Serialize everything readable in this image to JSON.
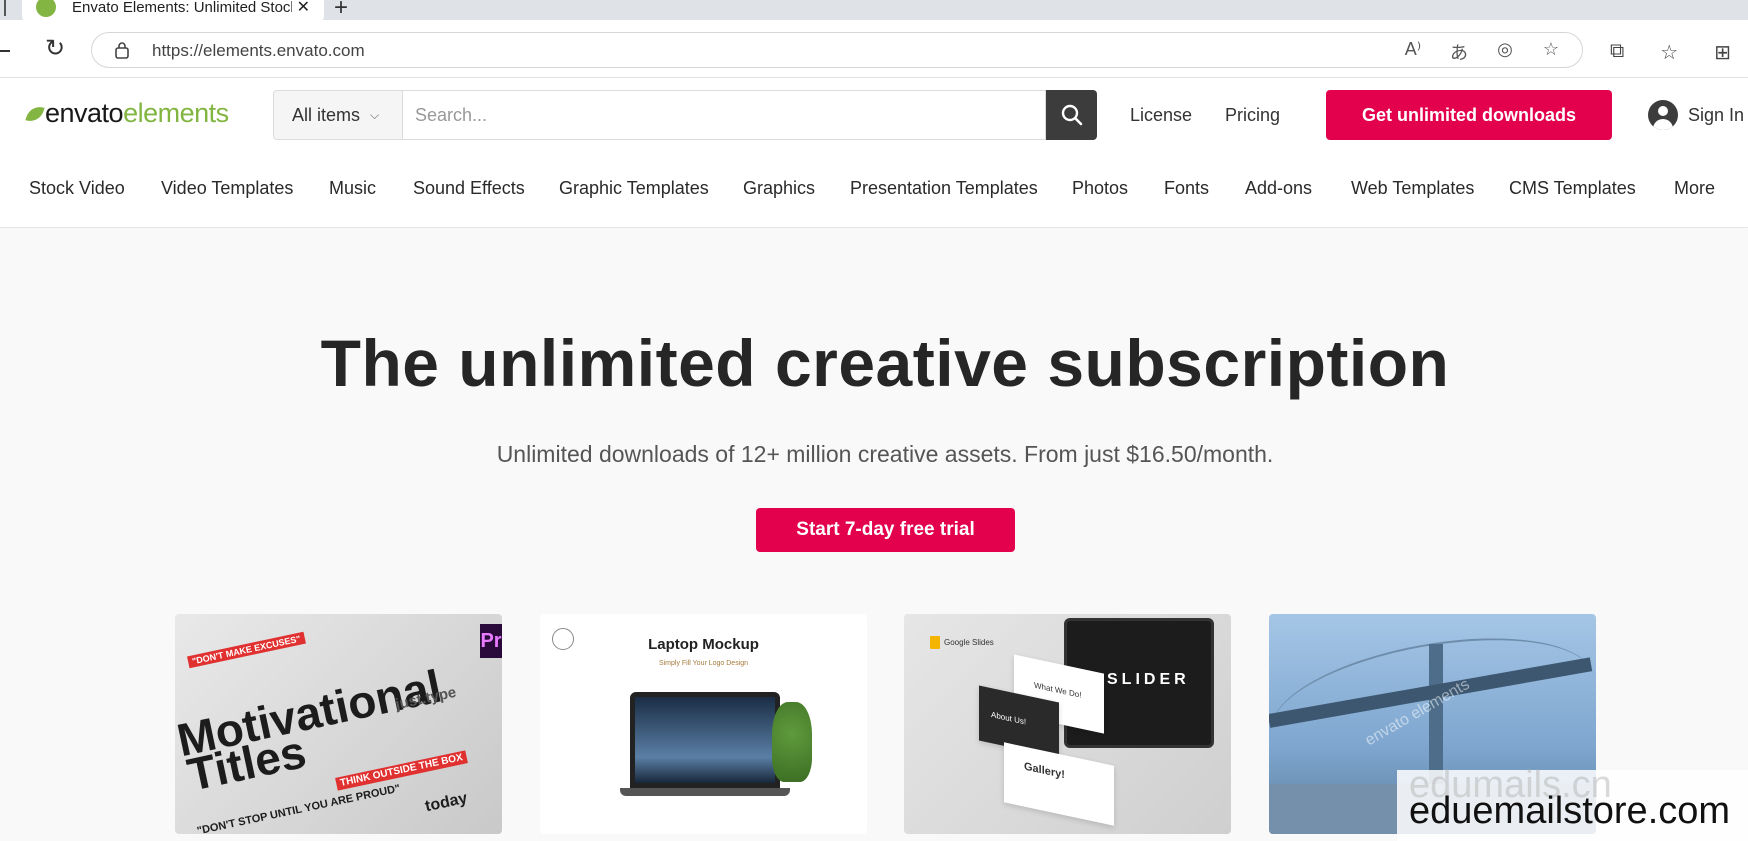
{
  "browser": {
    "tab_title": "Envato Elements: Unlimited Stock",
    "tab_close": "✕",
    "new_tab": "+",
    "url": "https://elements.envato.com"
  },
  "header": {
    "logo_envato": "envato",
    "logo_elements": "elements",
    "filter_label": "All items",
    "search_placeholder": "Search...",
    "license": "License",
    "pricing": "Pricing",
    "cta": "Get unlimited downloads",
    "sign_in": "Sign In"
  },
  "categories": [
    "Stock Video",
    "Video Templates",
    "Music",
    "Sound Effects",
    "Graphic Templates",
    "Graphics",
    "Presentation Templates",
    "Photos",
    "Fonts",
    "Add-ons",
    "Web Templates",
    "CMS Templates",
    "More"
  ],
  "hero": {
    "title": "The unlimited creative subscription",
    "subtitle": "Unlimited downloads of 12+ million creative assets. From just $16.50/month.",
    "cta": "Start 7-day free trial"
  },
  "cards": {
    "motivational": {
      "word1": "Motivational",
      "word2": "Titles",
      "tag1": "\"DON'T MAKE EXCUSES\"",
      "tag2": "THINK OUTSIDE THE BOX",
      "tag3": "just.type",
      "tag4": "\"DON'T STOP UNTIL YOU ARE PROUD\"",
      "tag5": "today",
      "badge": "Pr"
    },
    "laptop": {
      "title": "Laptop Mockup",
      "subtitle": "Simply Fill Your Logo Design"
    },
    "slides": {
      "logo": "Google Slides",
      "monitor": "SLIDER",
      "label1": "What We Do!",
      "label2": "About Us!",
      "label3": "Gallery!"
    },
    "bridge": {
      "watermark": "envato elements"
    }
  },
  "watermark": "eduemailstore.com",
  "watermark_ghost": "edumails.cn"
}
